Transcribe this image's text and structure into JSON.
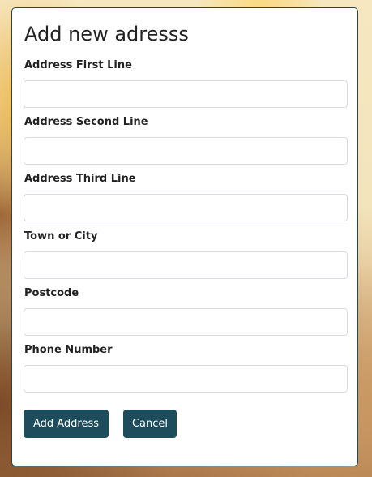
{
  "form": {
    "title": "Add new adresss",
    "fields": [
      {
        "label": "Address First Line",
        "value": "",
        "placeholder": ""
      },
      {
        "label": "Address Second Line",
        "value": "",
        "placeholder": ""
      },
      {
        "label": "Address Third Line",
        "value": "",
        "placeholder": ""
      },
      {
        "label": "Town or City",
        "value": "",
        "placeholder": ""
      },
      {
        "label": "Postcode",
        "value": "",
        "placeholder": ""
      },
      {
        "label": "Phone Number",
        "value": "",
        "placeholder": ""
      }
    ],
    "submit_label": "Add Address",
    "cancel_label": "Cancel"
  },
  "colors": {
    "button_bg": "#1d4d5c",
    "card_border": "#1c4a57"
  }
}
